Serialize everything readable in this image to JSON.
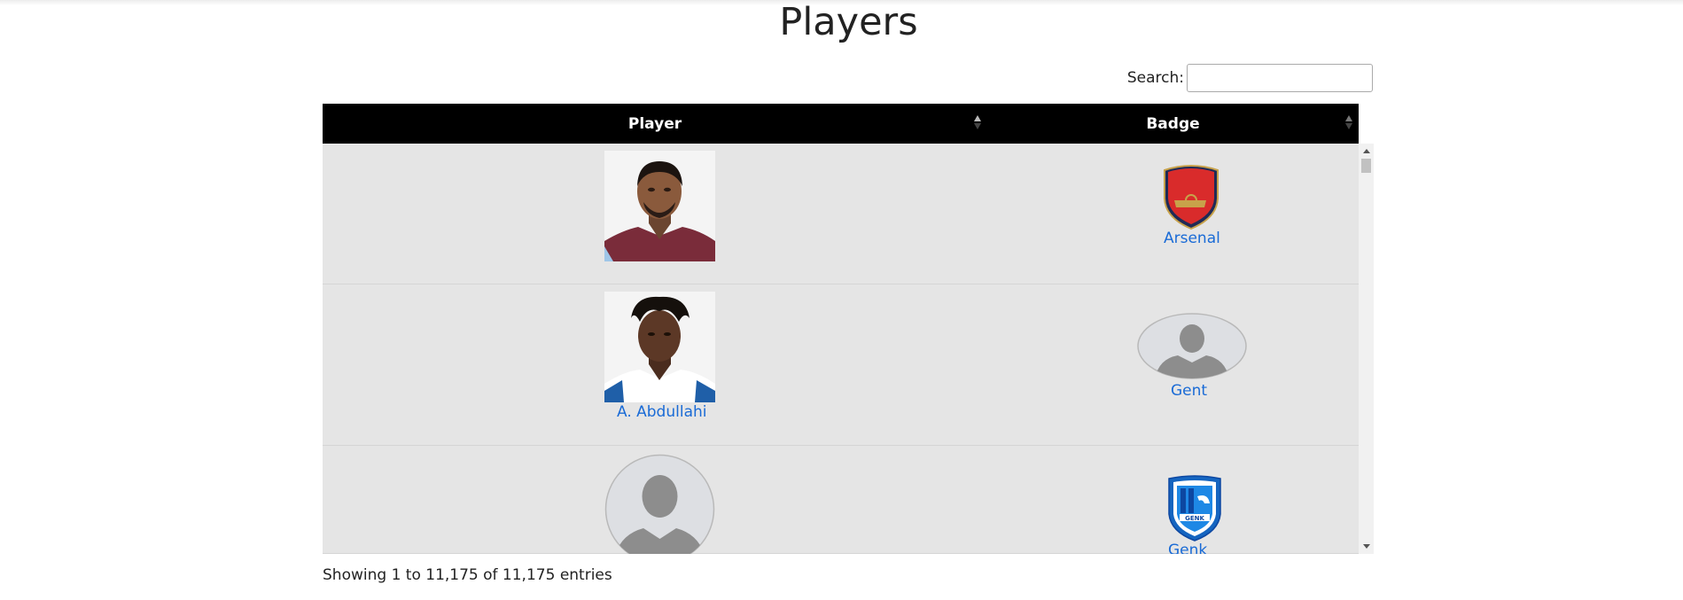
{
  "page": {
    "title": "Players"
  },
  "search": {
    "label": "Search:",
    "value": ""
  },
  "table": {
    "columns": [
      {
        "label": "Player",
        "sort": "ascending"
      },
      {
        "label": "Badge",
        "sort": "none"
      }
    ],
    "rows": [
      {
        "player_name": "",
        "player_image": "player-photo",
        "club": "Arsenal",
        "badge": "arsenal-crest"
      },
      {
        "player_name": "A. Abdullahi",
        "player_image": "player-photo",
        "club": "Gent",
        "badge": "placeholder-silhouette"
      },
      {
        "player_name": "",
        "player_image": "placeholder-silhouette",
        "club": "Genk",
        "badge": "genk-crest"
      }
    ]
  },
  "info": {
    "text": "Showing 1 to 11,175 of 11,175 entries"
  },
  "colors": {
    "header_bg": "#000000",
    "row_bg": "#e5e5e5",
    "link": "#1a6bd6"
  }
}
